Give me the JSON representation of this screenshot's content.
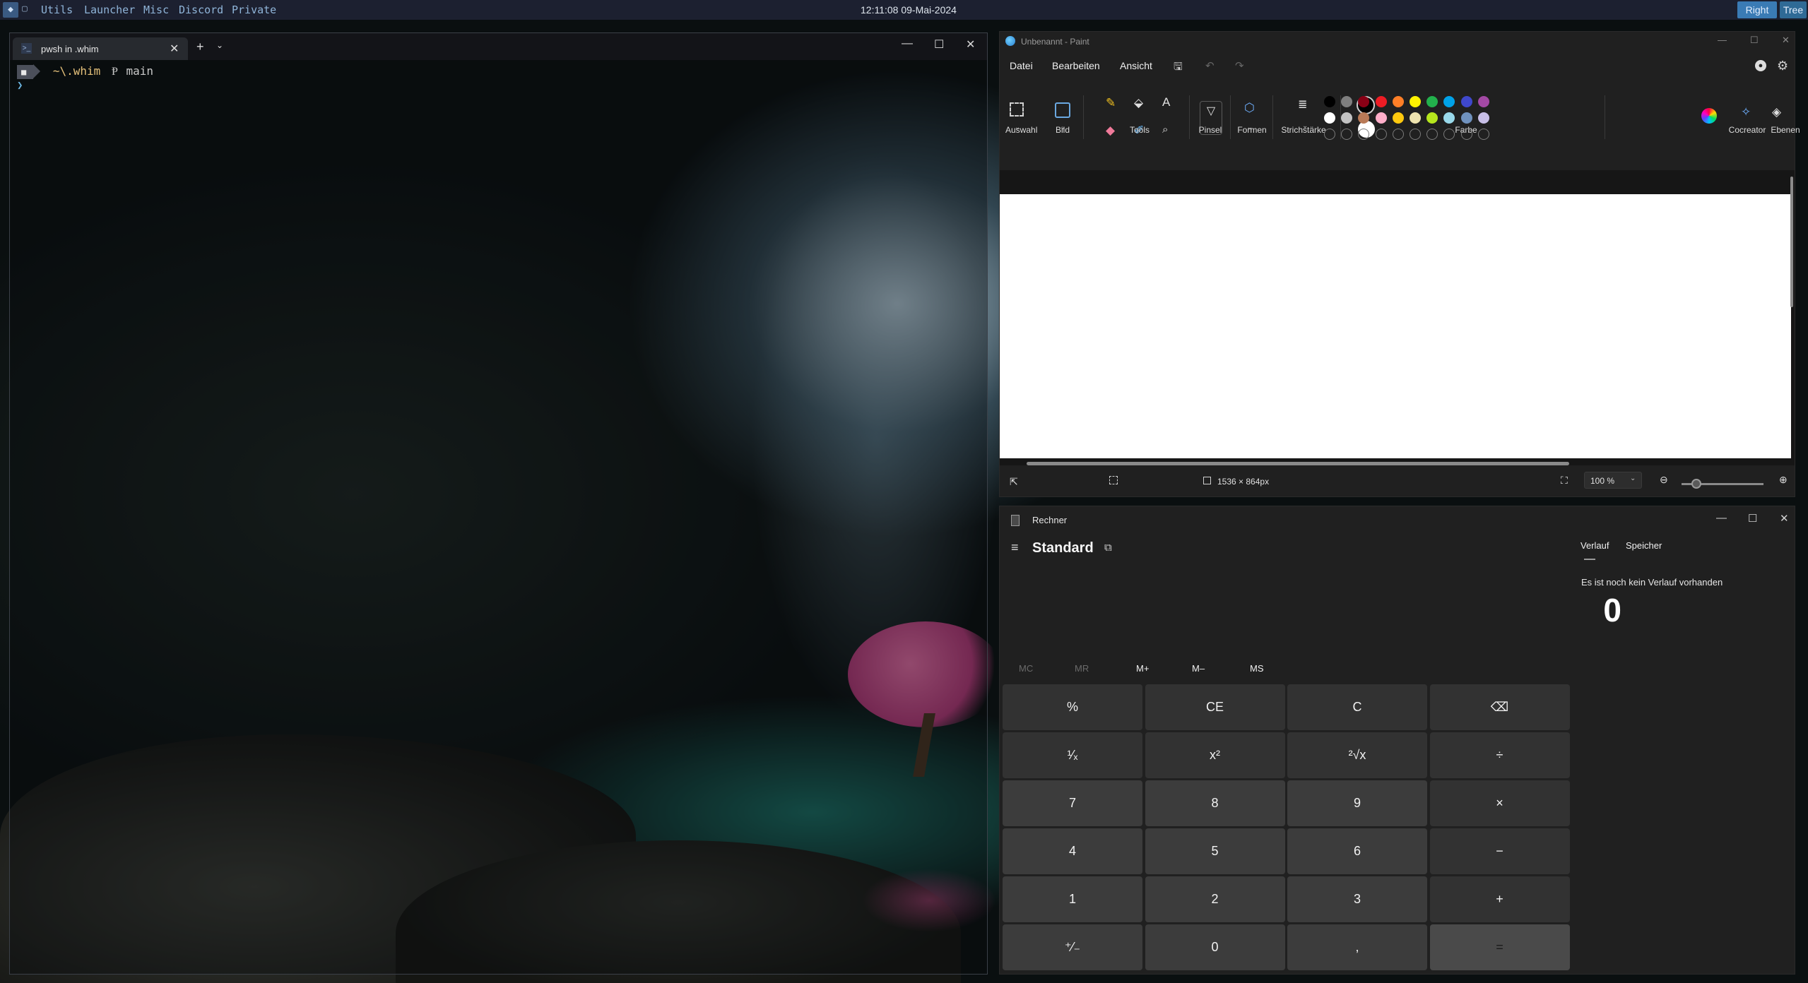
{
  "topbar": {
    "home_icon": "◆",
    "workspaces": [
      "Utils",
      "Launcher",
      "Misc",
      "Discord",
      "Private"
    ],
    "clock": "12:11:08 09-Mai-2024",
    "layout_buttons": [
      "Right",
      "Tree"
    ]
  },
  "terminal": {
    "tab_title": "pwsh in .whim",
    "tab_close": "✕",
    "new_tab": "+",
    "dropdown": "⌄",
    "window_controls": [
      "—",
      "☐",
      "✕"
    ],
    "prompt": {
      "os_badge": "■",
      "path": "~\\.whim",
      "git_icon": "Ᵽ",
      "branch": "main",
      "caret": "❯"
    }
  },
  "paint": {
    "title": "Unbenannt - Paint",
    "window_controls": [
      "—",
      "☐",
      "✕"
    ],
    "menu": [
      "Datei",
      "Bearbeiten",
      "Ansicht"
    ],
    "ribbon_groups": [
      "Auswahl",
      "Bild",
      "Tools",
      "Pinsel",
      "Formen",
      "Strichstärke",
      "Farbe",
      "Cocreator",
      "Ebenen"
    ],
    "colors_row1": [
      "#000000",
      "#7f7f7f",
      "#880015",
      "#ed1c24",
      "#ff7f27",
      "#fff200",
      "#22b14c",
      "#00a2e8",
      "#3f48cc",
      "#a349a4"
    ],
    "colors_row2": [
      "#ffffff",
      "#c3c3c3",
      "#b97a57",
      "#ffaec9",
      "#ffc90e",
      "#efe4b0",
      "#b5e61d",
      "#99d9ea",
      "#7092be",
      "#c8bfe7"
    ],
    "status": {
      "canvas_size": "1536 × 864px",
      "zoom": "100 %"
    }
  },
  "calculator": {
    "title": "Rechner",
    "window_controls": [
      "—",
      "☐",
      "✕"
    ],
    "menu_icon": "≡",
    "mode": "Standard",
    "keep_on_top_icon": "⧉",
    "display": "0",
    "memory": [
      "MC",
      "MR",
      "M+",
      "M–",
      "MS"
    ],
    "keys": [
      [
        "%",
        "CE",
        "C",
        "⌫"
      ],
      [
        "¹⁄ₓ",
        "x²",
        "²√x",
        "÷"
      ],
      [
        "7",
        "8",
        "9",
        "×"
      ],
      [
        "4",
        "5",
        "6",
        "−"
      ],
      [
        "1",
        "2",
        "3",
        "+"
      ],
      [
        "⁺⁄₋",
        "0",
        ",",
        "="
      ]
    ],
    "side_tabs": [
      "Verlauf",
      "Speicher"
    ],
    "history_empty": "Es ist noch kein Verlauf vorhanden"
  }
}
